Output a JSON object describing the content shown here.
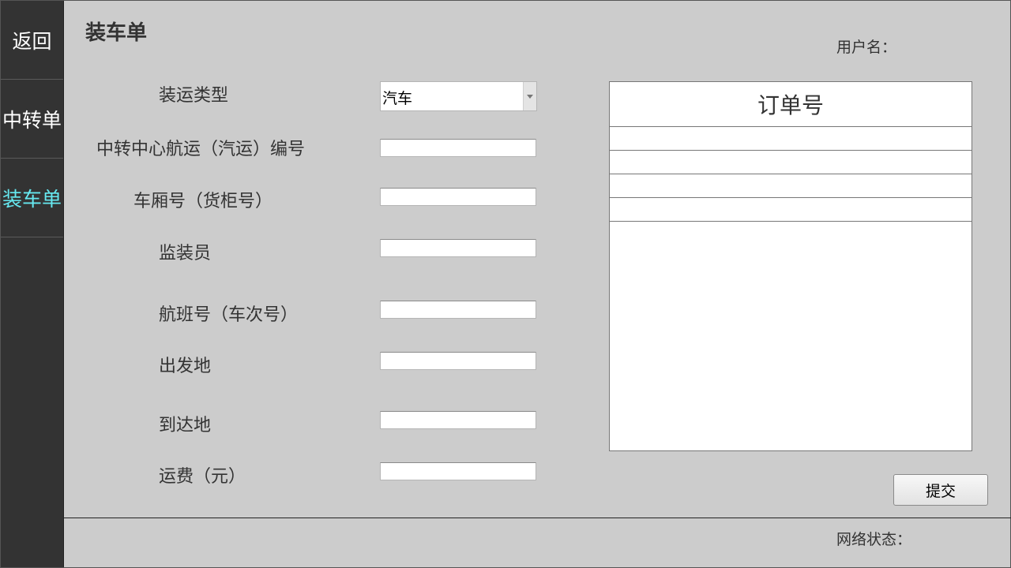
{
  "sidebar": {
    "items": [
      {
        "label": "返回"
      },
      {
        "label": "中转单"
      },
      {
        "label": "装车单"
      }
    ]
  },
  "header": {
    "title": "装车单",
    "user_label": "用户名："
  },
  "form": {
    "shipping_type": {
      "label": "装运类型",
      "value": "汽车"
    },
    "transfer_center_no": {
      "label": "中转中心航运（汽运）编号",
      "value": ""
    },
    "carriage_no": {
      "label": "车厢号（货柜号）",
      "value": ""
    },
    "supervisor": {
      "label": "监装员",
      "value": ""
    },
    "flight_no": {
      "label": "航班号（车次号）",
      "value": ""
    },
    "origin": {
      "label": "出发地",
      "value": ""
    },
    "destination": {
      "label": "到达地",
      "value": ""
    },
    "freight": {
      "label": "运费（元）",
      "value": ""
    }
  },
  "order_table": {
    "header": "订单号",
    "rows": [
      "",
      "",
      "",
      ""
    ]
  },
  "submit_label": "提交",
  "footer": {
    "network_label": "网络状态："
  },
  "colors": {
    "sidebar_bg": "#333333",
    "active_nav": "#66e8f0",
    "page_bg": "#cccccc"
  }
}
